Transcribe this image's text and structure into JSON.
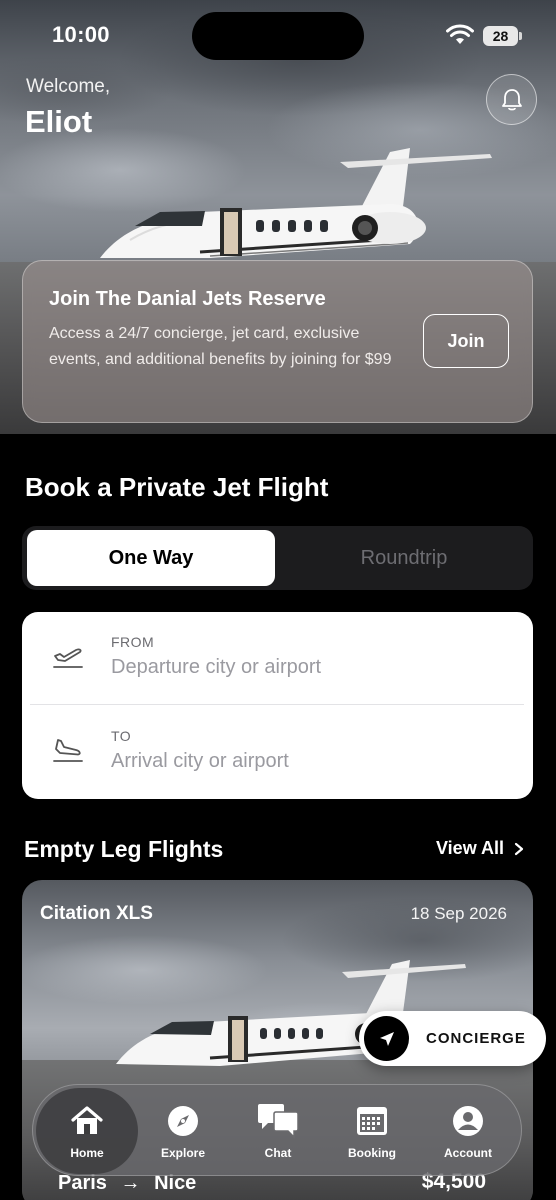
{
  "status_bar": {
    "time": "10:00",
    "battery": "28"
  },
  "header": {
    "welcome": "Welcome,",
    "user_name": "Eliot"
  },
  "reserve": {
    "title": "Join The Danial Jets Reserve",
    "description": "Access a 24/7 concierge, jet card, exclusive events, and additional benefits by joining for $99",
    "button": "Join"
  },
  "book": {
    "title": "Book a Private Jet Flight",
    "trip_types": [
      "One Way",
      "Roundtrip"
    ],
    "selected_trip_type": "One Way",
    "from_label": "FROM",
    "from_placeholder": "Departure city or airport",
    "to_label": "TO",
    "to_placeholder": "Arrival city or airport"
  },
  "empty_legs": {
    "title": "Empty Leg Flights",
    "view_all": "View All",
    "flights": [
      {
        "aircraft": "Citation XLS",
        "date": "18 Sep 2026",
        "origin": "Paris",
        "arrow": "→",
        "destination": "Nice",
        "price": "$4,500"
      }
    ]
  },
  "concierge": {
    "label": "CONCIERGE"
  },
  "tabs": [
    {
      "label": "Home",
      "icon": "home-icon",
      "active": true
    },
    {
      "label": "Explore",
      "icon": "compass-icon",
      "active": false
    },
    {
      "label": "Chat",
      "icon": "chat-bubbles-icon",
      "active": false
    },
    {
      "label": "Booking",
      "icon": "calendar-icon",
      "active": false
    },
    {
      "label": "Account",
      "icon": "account-icon",
      "active": false
    }
  ],
  "colors": {
    "background": "#000000",
    "card": "#ffffff",
    "segment_bg": "#1c1c1e",
    "inactive_text": "#6d6d72",
    "placeholder": "#9a9aa0"
  }
}
